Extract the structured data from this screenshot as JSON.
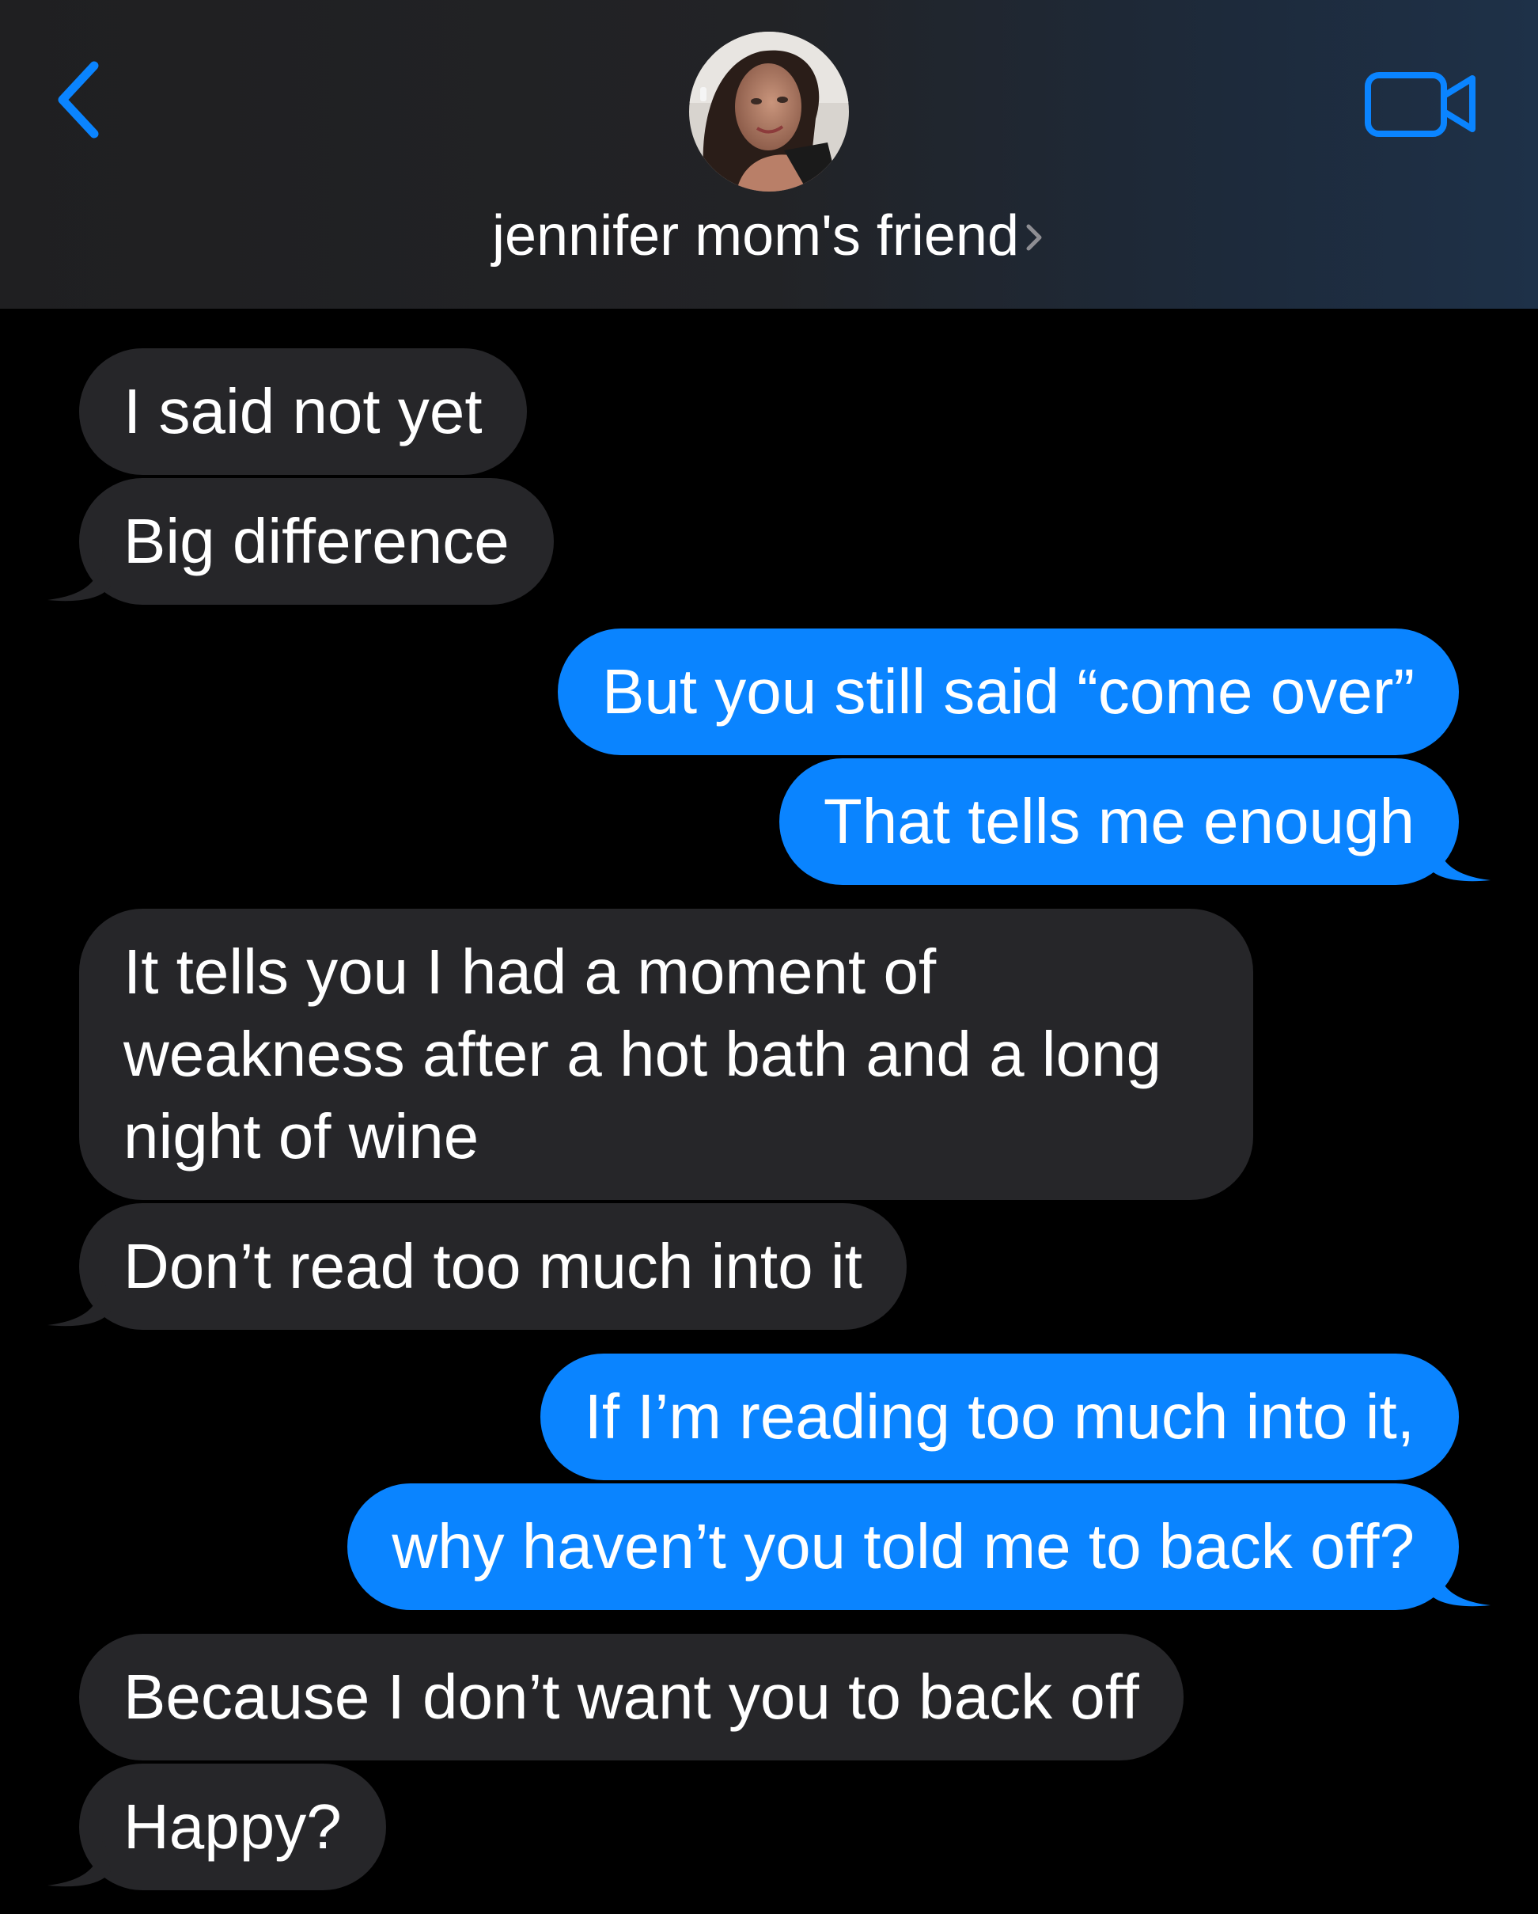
{
  "header": {
    "contact_name": "jennifer mom's friend",
    "back_icon": "chevron-left-icon",
    "video_icon": "video-camera-icon",
    "accent_color": "#0a84ff"
  },
  "messages": [
    {
      "from": "them",
      "text": "I said not yet"
    },
    {
      "from": "them",
      "text": "Big difference"
    },
    {
      "from": "me",
      "text": "But you still said “come over”"
    },
    {
      "from": "me",
      "text": "That tells me enough"
    },
    {
      "from": "them",
      "text": "It tells you I had a moment of weakness after a hot bath and a long night of wine"
    },
    {
      "from": "them",
      "text": "Don’t read too much into it"
    },
    {
      "from": "me",
      "text": "If I’m reading too much into it,"
    },
    {
      "from": "me",
      "text": "why haven’t you told me to back off?"
    },
    {
      "from": "them",
      "text": "Because I don’t want you to back off"
    },
    {
      "from": "them",
      "text": "Happy?"
    }
  ],
  "colors": {
    "received_bubble": "#262629",
    "sent_bubble": "#0a84ff",
    "background": "#000000"
  }
}
